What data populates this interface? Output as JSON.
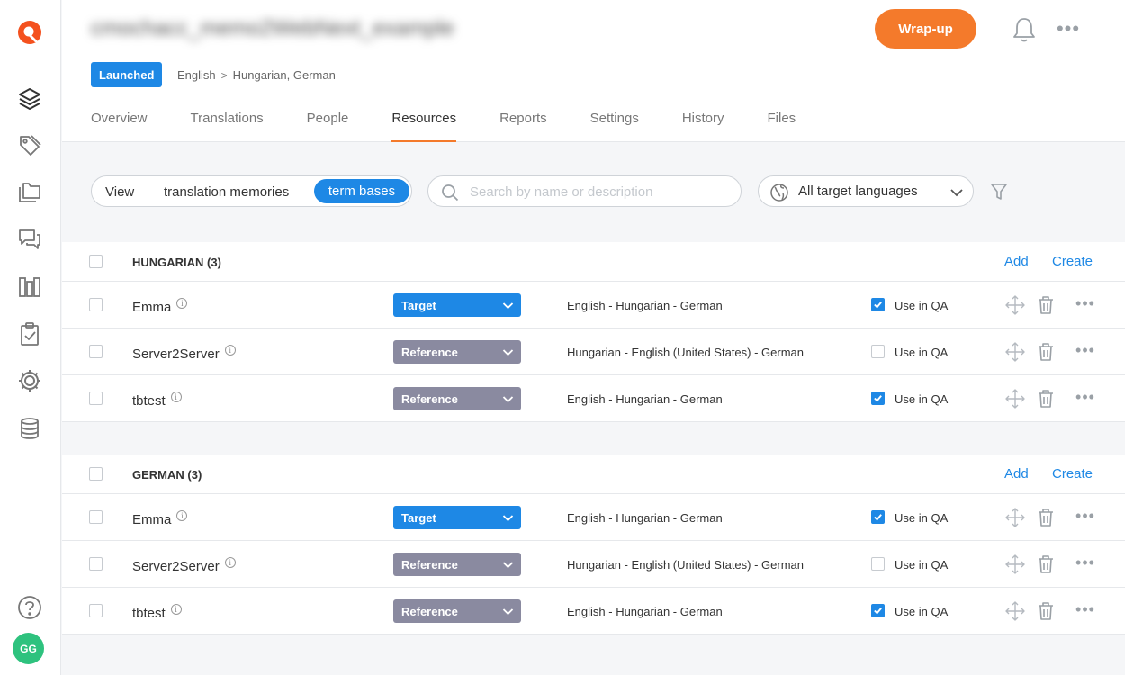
{
  "project": {
    "title": "cmochacc_memo2WebNext_example",
    "status_badge": "Launched",
    "source_language": "English",
    "target_languages": "Hungarian, German",
    "wrapup_label": "Wrap-up"
  },
  "tabs": [
    {
      "label": "Overview"
    },
    {
      "label": "Translations"
    },
    {
      "label": "People"
    },
    {
      "label": "Resources",
      "active": true
    },
    {
      "label": "Reports"
    },
    {
      "label": "Settings"
    },
    {
      "label": "History"
    },
    {
      "label": "Files"
    }
  ],
  "filter": {
    "view_label": "View",
    "tm_label": "translation memories",
    "tb_label": "term bases",
    "search_placeholder": "Search by name or description",
    "language_filter": "All target languages"
  },
  "sections": [
    {
      "title": "HUNGARIAN (3)",
      "add_label": "Add",
      "create_label": "Create",
      "rows": [
        {
          "name": "Emma",
          "role": "Target",
          "languages": "English - Hungarian - German",
          "use_in_qa": true,
          "qa_label": "Use in QA"
        },
        {
          "name": "Server2Server",
          "role": "Reference",
          "languages": "Hungarian - English (United States) - German",
          "use_in_qa": false,
          "qa_label": "Use in QA"
        },
        {
          "name": "tbtest",
          "role": "Reference",
          "languages": "English - Hungarian - German",
          "use_in_qa": true,
          "qa_label": "Use in QA"
        }
      ]
    },
    {
      "title": "GERMAN (3)",
      "add_label": "Add",
      "create_label": "Create",
      "rows": [
        {
          "name": "Emma",
          "role": "Target",
          "languages": "English - Hungarian - German",
          "use_in_qa": true,
          "qa_label": "Use in QA"
        },
        {
          "name": "Server2Server",
          "role": "Reference",
          "languages": "Hungarian - English (United States) - German",
          "use_in_qa": false,
          "qa_label": "Use in QA"
        },
        {
          "name": "tbtest",
          "role": "Reference",
          "languages": "English - Hungarian - German",
          "use_in_qa": true,
          "qa_label": "Use in QA"
        }
      ]
    }
  ],
  "user": {
    "initials": "GG"
  },
  "colors": {
    "accent": "#1e88e5",
    "wrapup": "#f47a2b",
    "reference": "#8a8aa0",
    "avatar": "#2ec27e",
    "logo": "#f4511e"
  }
}
